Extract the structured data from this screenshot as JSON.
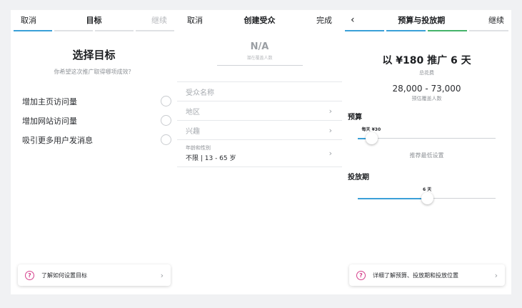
{
  "panel1": {
    "cancel": "取消",
    "center": "目标",
    "next": "继续",
    "title": "选择目标",
    "subtitle": "你希望这次推广取得哪项成效？",
    "options": [
      "增加主页访问量",
      "增加网站访问量",
      "吸引更多用户发消息"
    ],
    "help": "了解如何设置目标"
  },
  "panel2": {
    "cancel": "取消",
    "center": "创建受众",
    "done": "完成",
    "metric_value": "N/A",
    "metric_label": "潜在覆盖人数",
    "audience_name": "受众名称",
    "location": "地区",
    "interests": "兴趣",
    "age_gender_label": "年龄和性别",
    "age_gender_value": "不限 | 13 - 65 岁"
  },
  "panel3": {
    "center": "预算与投放期",
    "next": "继续",
    "promo": "以 ¥180 推广 6 天",
    "promo_sub": "总花费",
    "reach": "28,000 - 73,000",
    "reach_sub": "预估覆盖人数",
    "budget_label": "预算",
    "budget_value": "每天 ¥30",
    "budget_level": 0.1,
    "recommend": "推荐最低设置",
    "period_label": "投放期",
    "period_value": "6 天",
    "period_level": 0.5,
    "help": "详细了解预算、投放期和投放位置"
  },
  "colors": {
    "accent_blue": "#3aa0d8",
    "accent_green": "#45b36a",
    "help_icon": "#d53f8c"
  }
}
